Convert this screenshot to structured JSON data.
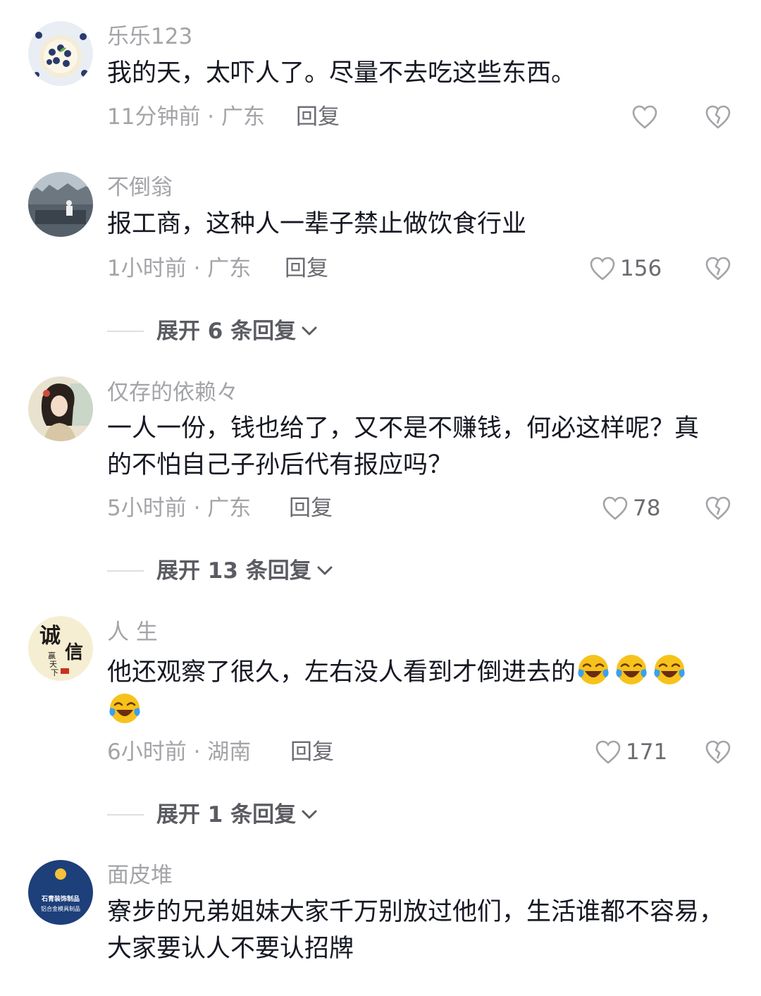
{
  "comments": [
    {
      "username": "乐乐123",
      "text": "我的天，太吓人了。尽量不去吃这些东西。",
      "meta": "11分钟前 · 广东",
      "reply_label": "回复",
      "likes": ""
    },
    {
      "username": "不倒翁",
      "text": "报工商，这种人一辈子禁止做饮食行业",
      "meta": "1小时前 · 广东",
      "reply_label": "回复",
      "likes": "156",
      "expand": "展开 6 条回复"
    },
    {
      "username": "仅存的依赖々",
      "text": "一人一份，钱也给了，又不是不赚钱，何必这样呢？真的不怕自己子孙后代有报应吗？",
      "meta": "5小时前 · 广东",
      "reply_label": "回复",
      "likes": "78",
      "expand": "展开 13 条回复"
    },
    {
      "username": "人 生",
      "text": "他还观察了很久，左右没人看到才倒进去的",
      "emoji_name": "laughing-crying-emoji",
      "emoji_count": 4,
      "meta": "6小时前 · 湖南",
      "reply_label": "回复",
      "likes": "171",
      "expand": "展开 1 条回复",
      "avatar_text": [
        "诚",
        "信",
        "赢",
        "天",
        "下"
      ]
    },
    {
      "username": "面皮堆",
      "text": "寮步的兄弟姐妹大家千万别放过他们，生活谁都不容易，大家要认人不要认招牌",
      "avatar_text": [
        "石青装饰制品",
        "铝合金模具制品"
      ]
    }
  ],
  "icons": {
    "like": "heart-outline-icon",
    "dislike": "broken-heart-icon",
    "expand": "chevron-down-icon"
  },
  "colors": {
    "text_primary": "#161823",
    "text_secondary": "#a3a4a8",
    "emoji_yellow": "#f7c21b",
    "tear_blue": "#3aa0f0"
  }
}
